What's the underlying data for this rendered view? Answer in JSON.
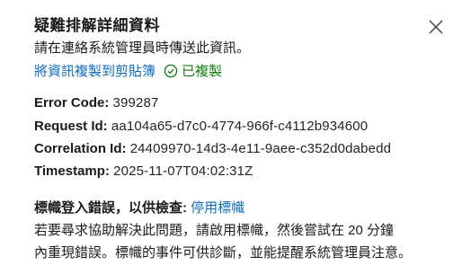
{
  "dialog": {
    "title": "疑難排解詳細資料",
    "subtitle": "請在連絡系統管理員時傳送此資訊。",
    "copy_link": "將資訊複製到剪貼簿",
    "copied_status": "已複製",
    "close_icon": "close-icon",
    "check_icon": "check-circle-icon"
  },
  "details": [
    {
      "label": "Error Code:",
      "value": "399287"
    },
    {
      "label": "Request Id:",
      "value": "aa104a65-d7c0-4774-966f-c4112b934600"
    },
    {
      "label": "Correlation Id:",
      "value": "24409970-14d3-4e11-9aee-c352d0dabedd"
    },
    {
      "label": "Timestamp:",
      "value": "2025-11-07T04:02:31Z"
    }
  ],
  "diagnostics": {
    "heading": "標幟登入錯誤，以供檢查:",
    "link": "停用標幟",
    "line1": "若要尋求協助解決此問題，請啟用標幟，然後嘗試在 20 分鐘",
    "line2": "內重現錯誤。標幟的事件可供診斷，並能提醒系統管理員注意。"
  },
  "colors": {
    "link": "#0f6cbd",
    "success": "#107c10",
    "text": "#1b1b1b"
  }
}
